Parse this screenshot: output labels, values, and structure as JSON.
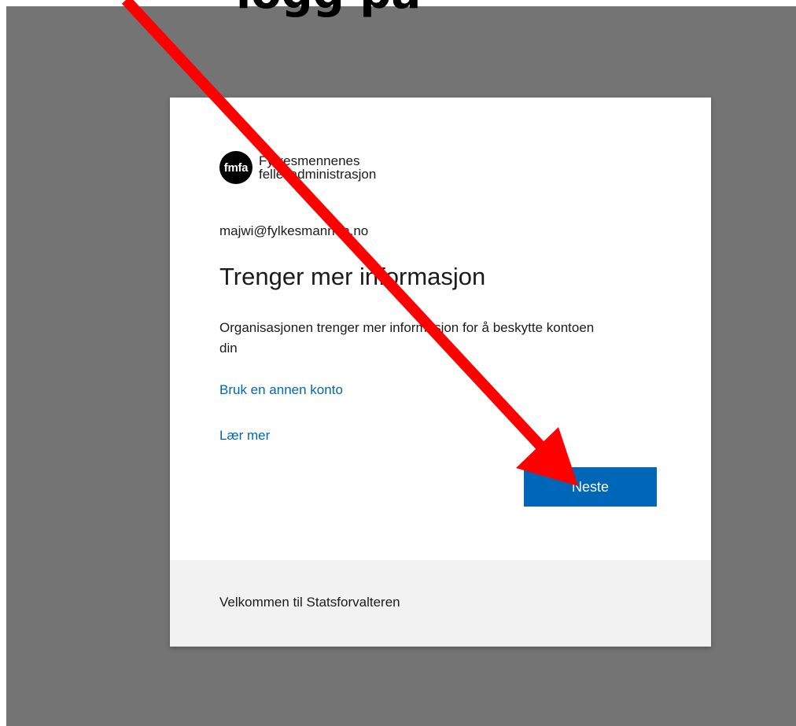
{
  "top_banner": {
    "text": "logg på"
  },
  "card": {
    "logo": {
      "initials": "fmfa",
      "name_line1": "Fylkesmennenes",
      "name_line2": "fellesadministrasjon"
    },
    "email": "majwi@fylkesmannen.no",
    "heading": "Trenger mer informasjon",
    "description": "Organisasjonen trenger mer informasjon for å beskytte kontoen din",
    "link_other_account": "Bruk en annen konto",
    "link_learn_more": "Lær mer",
    "next_button": "Neste"
  },
  "footer": {
    "text": "Velkommen til Statsforvalteren"
  },
  "colors": {
    "backdrop": "#747474",
    "accent": "#0067b8",
    "arrow": "#ff0000"
  },
  "icons": {
    "annotation_arrow": "red-arrow-icon"
  }
}
